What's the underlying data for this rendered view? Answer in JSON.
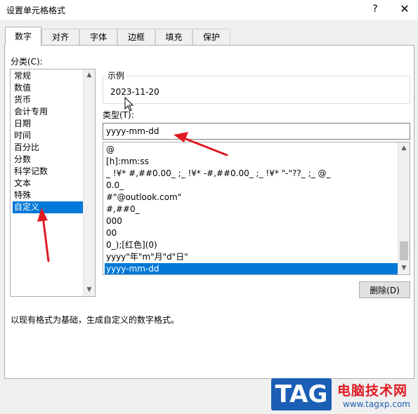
{
  "window": {
    "title": "设置单元格格式",
    "help_glyph": "?",
    "close_glyph": "✕"
  },
  "tabs": [
    {
      "label": "数字",
      "active": true
    },
    {
      "label": "对齐"
    },
    {
      "label": "字体"
    },
    {
      "label": "边框"
    },
    {
      "label": "填充"
    },
    {
      "label": "保护"
    }
  ],
  "category": {
    "label": "分类(C):",
    "items": [
      "常规",
      "数值",
      "货币",
      "会计专用",
      "日期",
      "时间",
      "百分比",
      "分数",
      "科学记数",
      "文本",
      "特殊",
      "自定义"
    ],
    "selected": "自定义"
  },
  "sample": {
    "legend": "示例",
    "value": "2023-11-20"
  },
  "type": {
    "label": "类型(T):",
    "value": "yyyy-mm-dd",
    "items": [
      "@",
      "[h]:mm:ss",
      "_ !¥* #,##0.00_ ;_ !¥* -#,##0.00_ ;_ !¥* \"-\"??_ ;_ @_",
      "0.0_",
      "#\"@outlook.com\"",
      "#,##0_",
      "000",
      "00",
      "0_);[红色](0)",
      "yyyy\"年\"m\"月\"d\"日\"",
      "yyyy-mm-dd"
    ],
    "selected": "yyyy-mm-dd"
  },
  "delete_button": "删除(D)",
  "description": "以现有格式为基础，生成自定义的数字格式。",
  "watermark": {
    "logo": "TAG",
    "title": "电脑技术网",
    "url": "www.tagxp.com"
  },
  "colors": {
    "selection": "#0078d7",
    "annotation_arrow": "#e01b24"
  }
}
